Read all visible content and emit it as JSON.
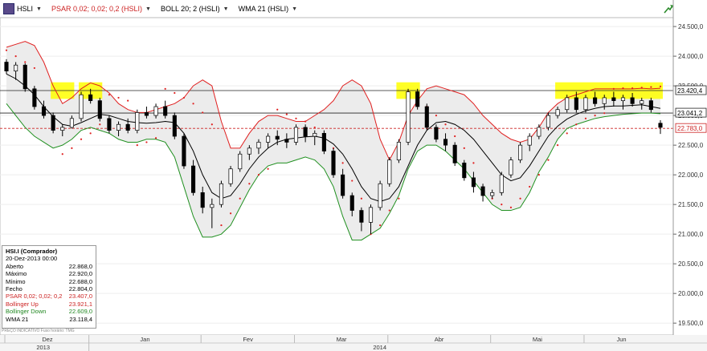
{
  "toolbar": {
    "symbol": "HSLI",
    "psar": "PSAR 0,02; 0,02; 0,2 (HSLI)",
    "boll": "BOLL 20; 2 (HSLI)",
    "wma": "WMA 21 (HSLI)"
  },
  "info_box": {
    "title": "HSI.I (Comprador)",
    "date": "20-Dez-2013 00:00",
    "rows": [
      {
        "label": "Aberto",
        "value": "22.868,0",
        "color": "#000000"
      },
      {
        "label": "Máximo",
        "value": "22.920,0",
        "color": "#000000"
      },
      {
        "label": "Mínimo",
        "value": "22.688,0",
        "color": "#000000"
      },
      {
        "label": "Fecho",
        "value": "22.804,0",
        "color": "#000000"
      },
      {
        "label": "PSAR 0,02; 0,02; 0,2",
        "value": "23.407,0",
        "color": "#cc2222"
      },
      {
        "label": "Bollinger Up",
        "value": "23.921,1",
        "color": "#cc2222"
      },
      {
        "label": "Bollinger Down",
        "value": "22.609,0",
        "color": "#228822"
      },
      {
        "label": "WMA 21",
        "value": "23.118,4",
        "color": "#000000"
      }
    ],
    "footnote": "PREÇO INDICATIVO   Fuso horário: TMG"
  },
  "chart_data": {
    "type": "candlestick",
    "y_axis": {
      "ticks": [
        "24.500,0",
        "24.000,0",
        "23.500,0",
        "23.000,0",
        "22.500,0",
        "22.000,0",
        "21.500,0",
        "21.000,0",
        "20.500,0",
        "20.000,0",
        "19.500,0"
      ],
      "tick_values": [
        24500,
        24000,
        23500,
        23000,
        22500,
        22000,
        21500,
        21000,
        20500,
        20000,
        19500
      ],
      "ylim": [
        19300,
        24650
      ]
    },
    "x_axis": {
      "months": [
        "Dez",
        "Jan",
        "Fev",
        "Mar",
        "Abr",
        "Mai",
        "Jun"
      ],
      "years": [
        "2013",
        "2014"
      ]
    },
    "horizontal_lines": [
      {
        "value": 23420.4,
        "label": "23.420,4",
        "style": "solid",
        "color": "#222222"
      },
      {
        "value": 23041.2,
        "label": "23.041,2",
        "style": "solid",
        "color": "#222222"
      },
      {
        "value": 22783.0,
        "label": "22.783,0",
        "style": "dashed",
        "color": "#cc2222"
      }
    ],
    "series_colors": {
      "bollinger_up": "#e02020",
      "bollinger_down": "#209020",
      "wma": "#000000",
      "psar": "#e02020",
      "up_candle": "#ffffff",
      "down_candle": "#000000",
      "band_fill": "#ececec",
      "highlight": "#ffff00"
    },
    "wma": [
      23700,
      23620,
      23500,
      23350,
      23150,
      22980,
      22850,
      22820,
      22880,
      22950,
      23020,
      23000,
      22950,
      22900,
      22880,
      22870,
      22880,
      22900,
      22880,
      22700,
      22400,
      22000,
      21700,
      21600,
      21650,
      21850,
      22100,
      22300,
      22450,
      22550,
      22600,
      22620,
      22640,
      22650,
      22620,
      22520,
      22350,
      22100,
      21800,
      21600,
      21550,
      21600,
      21800,
      22150,
      22500,
      22750,
      22880,
      22900,
      22850,
      22750,
      22600,
      22400,
      22200,
      22000,
      21900,
      21950,
      22150,
      22400,
      22650,
      22820,
      22940,
      23020,
      23080,
      23120,
      23150,
      23160,
      23160,
      23170,
      23180,
      23150,
      23120
    ],
    "boll_up": [
      24150,
      24200,
      24250,
      24180,
      23900,
      23500,
      23200,
      23300,
      23450,
      23550,
      23500,
      23380,
      23200,
      23100,
      23050,
      23050,
      23100,
      23150,
      23200,
      23300,
      23500,
      23600,
      23500,
      22900,
      22450,
      22450,
      22700,
      22900,
      23000,
      23000,
      22950,
      22900,
      22900,
      23000,
      23100,
      23250,
      23500,
      23600,
      23500,
      23200,
      22600,
      22250,
      22550,
      23000,
      23250,
      23450,
      23500,
      23450,
      23400,
      23350,
      23200,
      23000,
      22850,
      22700,
      22600,
      22550,
      22600,
      22800,
      23050,
      23200,
      23300,
      23350,
      23400,
      23450,
      23450,
      23450,
      23450,
      23450,
      23460,
      23450,
      23460
    ],
    "boll_down": [
      23200,
      23000,
      22800,
      22650,
      22550,
      22450,
      22500,
      22600,
      22750,
      22800,
      22750,
      22700,
      22600,
      22550,
      22550,
      22600,
      22600,
      22550,
      22300,
      21800,
      21300,
      20950,
      20950,
      21000,
      21150,
      21450,
      21750,
      22000,
      22150,
      22200,
      22200,
      22250,
      22300,
      22250,
      22100,
      21800,
      21300,
      20900,
      20900,
      21000,
      21100,
      21350,
      21650,
      22100,
      22400,
      22500,
      22500,
      22400,
      22250,
      22100,
      21900,
      21700,
      21500,
      21400,
      21400,
      21450,
      21700,
      22050,
      22300,
      22600,
      22780,
      22850,
      22900,
      22950,
      22980,
      23000,
      23020,
      23030,
      23040,
      23040,
      23030
    ],
    "psar": [
      24100,
      24000,
      23900,
      23800,
      null,
      null,
      22350,
      22450,
      22600,
      22700,
      22850,
      23350,
      23300,
      23250,
      22500,
      22550,
      22620,
      23450,
      23380,
      23300,
      23200,
      23050,
      22850,
      21150,
      21350,
      21600,
      21850,
      22000,
      22100,
      23100,
      23020,
      22950,
      22900,
      22800,
      22650,
      22450,
      22200,
      21900,
      21600,
      21000,
      21150,
      21400,
      21600,
      23400,
      23300,
      23150,
      23000,
      22850,
      22650,
      22450,
      22200,
      21750,
      21600,
      21500,
      21450,
      21600,
      21800,
      22000,
      22250,
      22500,
      22700,
      22850,
      22950,
      23000,
      23040,
      23450,
      23460,
      23460,
      23470,
      23480,
      23490
    ],
    "candles": [
      [
        23900,
        23950,
        23700,
        23750
      ],
      [
        23750,
        23900,
        23600,
        23850
      ],
      [
        23850,
        23880,
        23400,
        23450
      ],
      [
        23450,
        23500,
        23100,
        23150
      ],
      [
        23150,
        23250,
        22950,
        23000
      ],
      [
        23000,
        23050,
        22700,
        22750
      ],
      [
        22750,
        22850,
        22650,
        22800
      ],
      [
        22800,
        23000,
        22780,
        22950
      ],
      [
        22950,
        23400,
        22900,
        23350
      ],
      [
        23350,
        23450,
        23200,
        23250
      ],
      [
        23250,
        23300,
        22900,
        22950
      ],
      [
        22950,
        23000,
        22700,
        22750
      ],
      [
        22750,
        22900,
        22650,
        22850
      ],
      [
        22850,
        22950,
        22700,
        22750
      ],
      [
        22750,
        23100,
        22700,
        23050
      ],
      [
        23050,
        23150,
        22950,
        23000
      ],
      [
        23000,
        23200,
        22950,
        23150
      ],
      [
        23150,
        23250,
        22950,
        23000
      ],
      [
        23000,
        23050,
        22600,
        22650
      ],
      [
        22650,
        22700,
        22100,
        22150
      ],
      [
        22150,
        22250,
        21650,
        21700
      ],
      [
        21700,
        21800,
        21350,
        21450
      ],
      [
        21450,
        21600,
        21100,
        21500
      ],
      [
        21500,
        21900,
        21450,
        21850
      ],
      [
        21850,
        22150,
        21800,
        22100
      ],
      [
        22100,
        22400,
        22050,
        22350
      ],
      [
        22350,
        22500,
        22250,
        22450
      ],
      [
        22450,
        22600,
        22350,
        22550
      ],
      [
        22550,
        22700,
        22450,
        22650
      ],
      [
        22650,
        22750,
        22500,
        22600
      ],
      [
        22600,
        22700,
        22450,
        22550
      ],
      [
        22550,
        22850,
        22500,
        22800
      ],
      [
        22800,
        22850,
        22550,
        22650
      ],
      [
        22650,
        22750,
        22500,
        22700
      ],
      [
        22700,
        22750,
        22350,
        22400
      ],
      [
        22400,
        22450,
        21950,
        22000
      ],
      [
        22000,
        22100,
        21600,
        21650
      ],
      [
        21650,
        21700,
        21300,
        21400
      ],
      [
        21400,
        21450,
        21050,
        21200
      ],
      [
        21200,
        21500,
        21000,
        21450
      ],
      [
        21450,
        21900,
        21400,
        21850
      ],
      [
        21850,
        22300,
        21800,
        22250
      ],
      [
        22250,
        22600,
        22200,
        22550
      ],
      [
        22550,
        23450,
        22500,
        23400
      ],
      [
        23400,
        23450,
        23100,
        23150
      ],
      [
        23150,
        23200,
        22750,
        22800
      ],
      [
        22800,
        22850,
        22550,
        22600
      ],
      [
        22600,
        22700,
        22400,
        22500
      ],
      [
        22500,
        22550,
        22150,
        22200
      ],
      [
        22200,
        22250,
        21900,
        21950
      ],
      [
        21950,
        22050,
        21700,
        21800
      ],
      [
        21800,
        21850,
        21550,
        21650
      ],
      [
        21650,
        21750,
        21600,
        21700
      ],
      [
        21700,
        22050,
        21650,
        22000
      ],
      [
        22000,
        22300,
        21950,
        22250
      ],
      [
        22250,
        22550,
        22200,
        22500
      ],
      [
        22500,
        22700,
        22400,
        22650
      ],
      [
        22650,
        22850,
        22600,
        22800
      ],
      [
        22800,
        23050,
        22750,
        23000
      ],
      [
        23000,
        23150,
        22950,
        23100
      ],
      [
        23100,
        23350,
        23050,
        23300
      ],
      [
        23300,
        23400,
        23050,
        23100
      ],
      [
        23100,
        23350,
        23050,
        23300
      ],
      [
        23300,
        23400,
        23150,
        23200
      ],
      [
        23200,
        23350,
        23100,
        23300
      ],
      [
        23300,
        23400,
        23150,
        23250
      ],
      [
        23250,
        23350,
        23100,
        23300
      ],
      [
        23300,
        23380,
        23150,
        23200
      ],
      [
        23200,
        23300,
        23100,
        23250
      ],
      [
        23250,
        23300,
        23050,
        23100
      ],
      [
        22870,
        22920,
        22690,
        22800
      ]
    ]
  }
}
